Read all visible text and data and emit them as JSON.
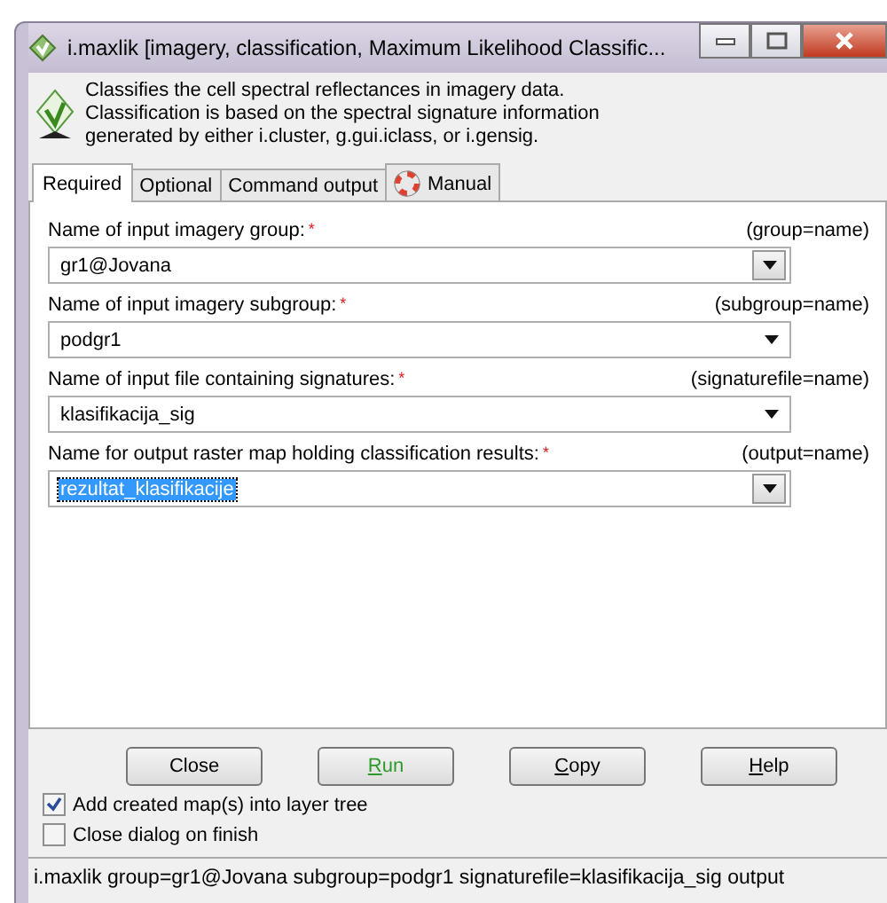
{
  "window": {
    "title": "i.maxlik [imagery, classification, Maximum Likelihood Classific..."
  },
  "description": "Classifies the cell spectral reflectances in imagery data.\nClassification is based on the spectral signature information\ngenerated by either i.cluster, g.gui.iclass, or i.gensig.",
  "tabs": [
    {
      "label": "Required",
      "selected": true,
      "icon": false
    },
    {
      "label": "Optional",
      "selected": false,
      "icon": false
    },
    {
      "label": "Command output",
      "selected": false,
      "icon": false
    },
    {
      "label": "Manual",
      "selected": false,
      "icon": true
    }
  ],
  "fields": [
    {
      "label": "Name of input imagery group:",
      "required": "*",
      "param": "(group=name)",
      "value": "gr1@Jovana",
      "kind": "boxed",
      "text_selected": false
    },
    {
      "label": "Name of input imagery subgroup:",
      "required": "*",
      "param": "(subgroup=name)",
      "value": "podgr1",
      "kind": "plain",
      "text_selected": false
    },
    {
      "label": "Name of input file containing signatures:",
      "required": "*",
      "param": "(signaturefile=name)",
      "value": "klasifikacija_sig",
      "kind": "plain",
      "text_selected": false
    },
    {
      "label": "Name for output raster map holding classification results:",
      "required": "*",
      "param": "(output=name)",
      "value": "rezultat_klasifikacije",
      "kind": "boxed",
      "text_selected": true
    }
  ],
  "buttons": [
    {
      "label": "Close",
      "color": "#000000",
      "underline_first": false
    },
    {
      "label": "Run",
      "color": "#2e9a2e",
      "underline_first": true
    },
    {
      "label": "Copy",
      "color": "#000000",
      "underline_first": true
    },
    {
      "label": "Help",
      "color": "#000000",
      "underline_first": true
    }
  ],
  "options": [
    {
      "label": "Add created map(s) into layer tree",
      "checked": true
    },
    {
      "label": "Close dialog on finish",
      "checked": false
    }
  ],
  "status_bar": "i.maxlik group=gr1@Jovana subgroup=podgr1 signaturefile=klasifikacija_sig output"
}
